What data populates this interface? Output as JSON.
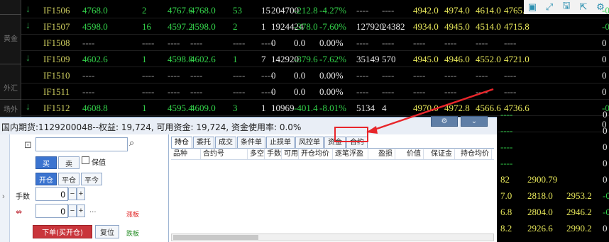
{
  "left_tabs": [
    "黄金",
    "外汇",
    "场外"
  ],
  "toolbar_icons": [
    "window-icon",
    "restore-icon",
    "save-icon",
    "export-icon",
    "settings-icon"
  ],
  "rows": [
    {
      "code": "IF1506",
      "dir": "down",
      "cols": [
        "4768.0",
        "2",
        "4767.6",
        "4768.0",
        "53",
        "15",
        "204700",
        "-212.8",
        "-4.27%",
        "----",
        "----",
        "4942.0",
        "4974.0",
        "4614.0",
        "4765.1"
      ]
    },
    {
      "code": "IF1507",
      "dir": "down",
      "cols": [
        "4598.0",
        "16",
        "4597.2",
        "4598.0",
        "2",
        "1",
        "1924424",
        "-378.0",
        "-7.60%",
        "127920",
        "24382",
        "4934.0",
        "4945.0",
        "4514.0",
        "4715.8"
      ]
    },
    {
      "code": "IF1508",
      "dir": "none",
      "cols": [
        "----",
        "----",
        "----",
        "----",
        "----",
        "----",
        "0",
        "0.0",
        "0.00%",
        "----",
        "----",
        "----",
        "----",
        "----",
        "----"
      ]
    },
    {
      "code": "IF1509",
      "dir": "down",
      "cols": [
        "4602.6",
        "1",
        "4598.8",
        "4602.6",
        "1",
        "7",
        "142920",
        "-379.6",
        "-7.62%",
        "35149",
        "570",
        "4945.0",
        "4946.0",
        "4552.0",
        "4721.0"
      ]
    },
    {
      "code": "IF1510",
      "dir": "none",
      "cols": [
        "----",
        "----",
        "----",
        "----",
        "----",
        "----",
        "0",
        "0.0",
        "0.00%",
        "----",
        "----",
        "----",
        "----",
        "----",
        "----"
      ]
    },
    {
      "code": "IF1511",
      "dir": "none",
      "cols": [
        "----",
        "----",
        "----",
        "----",
        "----",
        "----",
        "0",
        "0.0",
        "0.00%",
        "----",
        "----",
        "----",
        "----",
        "----",
        "----"
      ]
    },
    {
      "code": "IF1512",
      "dir": "down",
      "cols": [
        "4608.8",
        "1",
        "4595.4",
        "4609.0",
        "3",
        "1",
        "10969",
        "-401.4",
        "-8.01%",
        "5134",
        "4",
        "4970.0",
        "4972.8",
        "4566.6",
        "4736.6"
      ]
    },
    {
      "code": "IF1601",
      "dir": "none",
      "cols": [
        "----",
        "----",
        "----",
        "----",
        "----",
        "----",
        "0",
        "0.0",
        "0.00%",
        "",
        "",
        "",
        "",
        "",
        ""
      ]
    }
  ],
  "right_edge": [
    {
      "cols": [
        "",
        "",
        "-0"
      ]
    },
    {
      "cols": [
        "",
        "",
        "-0"
      ]
    },
    {
      "cols": [
        "",
        "",
        "0"
      ]
    },
    {
      "cols": [
        "",
        "",
        "0"
      ]
    },
    {
      "cols": [
        "",
        "",
        "0"
      ]
    },
    {
      "cols": [
        "",
        "",
        "0"
      ]
    },
    {
      "cols": [
        "",
        "",
        "-0"
      ]
    },
    {
      "cols": [
        "",
        "",
        "0"
      ]
    },
    {
      "cols": [
        "----",
        "",
        "0"
      ]
    },
    {
      "cols": [
        "----",
        "",
        "0"
      ]
    },
    {
      "cols": [
        "----",
        "",
        "0"
      ]
    },
    {
      "cols": [
        "----",
        "",
        "0"
      ]
    },
    {
      "cols": [
        "82",
        "2900.79",
        "0"
      ]
    },
    {
      "cols": [
        "7.0",
        "2818.0",
        "2953.2",
        "-0"
      ]
    },
    {
      "cols": [
        "6.8",
        "2804.0",
        "2946.2",
        "-0"
      ]
    },
    {
      "cols": [
        "8.2",
        "2926.6",
        "2990.2",
        "0"
      ]
    }
  ],
  "panel": {
    "title": "国内期货:1129200048--权益: 19,724, 可用资金: 19,724, 资金使用率: 0.0%",
    "win_buttons": [
      "⚙",
      "⌄"
    ],
    "search_icon": "search-icon",
    "buy": "买",
    "sell": "卖",
    "hedge": "保值",
    "open": "开仓",
    "close": "平仓",
    "close_today": "平今",
    "qty_label": "手数",
    "qty_value": "0",
    "price_value": "0",
    "price_dots": "...",
    "limit_up": "涨板",
    "limit_down": "跌板",
    "order_btn": "下单(买开仓)",
    "reset_btn": "复位",
    "tabs": [
      "持仓",
      "委托",
      "成交",
      "条件单",
      "止损单",
      "风控单",
      "资金",
      "合约"
    ],
    "headers": [
      "品种",
      "合约号",
      "多空",
      "手数",
      "可用",
      "开仓均价",
      "逐笔浮盈",
      "盈损",
      "价值",
      "保证金",
      "持仓均价"
    ]
  },
  "colors": {
    "green": "#33d24a",
    "red": "#ff4a4a",
    "yellow": "#e8e85a",
    "code": "#d0d060",
    "annotation": "#e8262b"
  }
}
